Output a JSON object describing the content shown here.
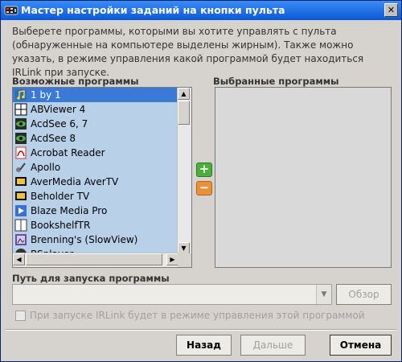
{
  "window": {
    "title": "Мастер настройки заданий на кнопки пульта",
    "close_label": "✕"
  },
  "intro_text": "Выберете программы, которыми вы хотите управлять с пульта (обнаруженные на компьютере выделены жирным). Также можно указать, в режиме управления какой программой будет находиться IRLink при запуске.",
  "available": {
    "label": "Возможные программы",
    "items": [
      {
        "label": "1 by 1",
        "icon": "music-note-icon",
        "selected": true
      },
      {
        "label": "ABViewer 4",
        "icon": "grid-icon"
      },
      {
        "label": "AcdSee 6, 7",
        "icon": "eye-icon"
      },
      {
        "label": "AcdSee 8",
        "icon": "eye-icon"
      },
      {
        "label": "Acrobat Reader",
        "icon": "pdf-icon"
      },
      {
        "label": "Apollo",
        "icon": "music-icon"
      },
      {
        "label": "AverMedia AverTV",
        "icon": "tv-icon"
      },
      {
        "label": "Beholder TV",
        "icon": "tv-icon"
      },
      {
        "label": "Blaze Media Pro",
        "icon": "media-icon"
      },
      {
        "label": "BookshelfTR",
        "icon": "book-icon"
      },
      {
        "label": "Brenning's (SlowView)",
        "icon": "image-icon"
      },
      {
        "label": "BSplayer",
        "icon": "player-icon"
      }
    ]
  },
  "selected": {
    "label": "Выбранные программы"
  },
  "add_button": "+",
  "remove_button": "−",
  "path": {
    "label": "Путь для запуска программы",
    "value": "",
    "browse_button": "Обзор"
  },
  "startup_checkbox": {
    "label": "При запуске IRLink будет в режиме управления этой программой",
    "checked": false
  },
  "buttons": {
    "back": "Назад",
    "next": "Дальше",
    "cancel": "Отмена"
  }
}
